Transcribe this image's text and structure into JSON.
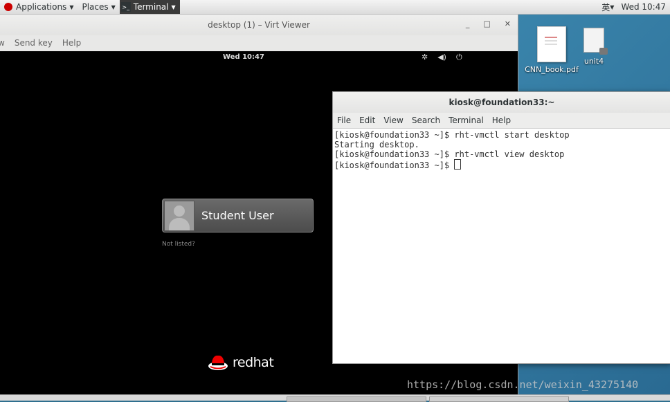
{
  "top_panel": {
    "applications": "Applications",
    "places": "Places",
    "terminal_task": "Terminal",
    "input_method": "英",
    "clock": "Wed 10:47"
  },
  "desktop": {
    "icons": [
      {
        "label": "CNN_book.pdf"
      },
      {
        "label": "unit4"
      }
    ]
  },
  "viewer": {
    "title": "desktop (1) – Virt Viewer",
    "menu": [
      "w",
      "Send key",
      "Help"
    ],
    "buttons": {
      "minimize": "_",
      "maximize": "□",
      "close": "✕"
    }
  },
  "vm": {
    "clock": "Wed 10:47",
    "user_name": "Student User",
    "not_listed": "Not listed?",
    "brand": "redhat"
  },
  "terminal": {
    "title": "kiosk@foundation33:~",
    "menu": [
      "File",
      "Edit",
      "View",
      "Search",
      "Terminal",
      "Help"
    ],
    "lines": [
      "[kiosk@foundation33 ~]$ rht-vmctl start desktop",
      "Starting desktop.",
      "[kiosk@foundation33 ~]$ rht-vmctl view desktop",
      "[kiosk@foundation33 ~]$ "
    ]
  },
  "watermark": "https://blog.csdn.net/weixin_43275140"
}
